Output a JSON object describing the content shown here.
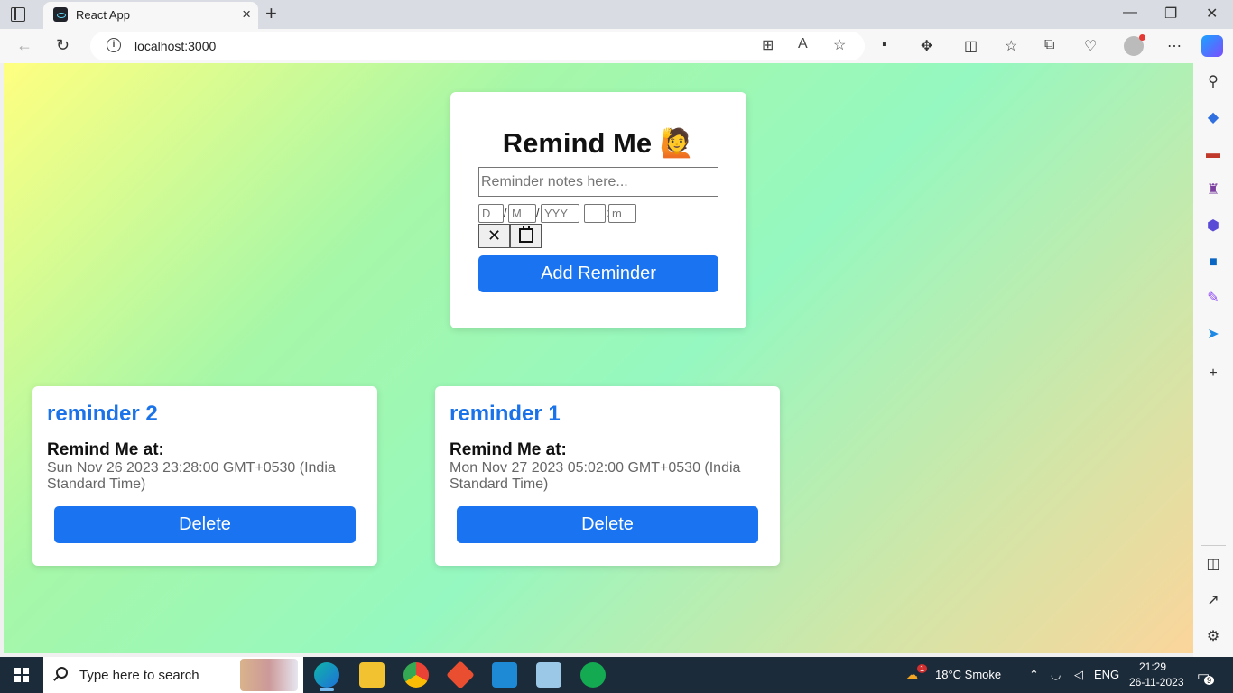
{
  "browser": {
    "tab_title": "React App",
    "new_tab_symbol": "+",
    "close_tab_symbol": "×",
    "url": "localhost:3000",
    "window_controls": [
      "—",
      "❐",
      "✕"
    ]
  },
  "page": {
    "title": "Remind Me 🙋",
    "note_placeholder": "Reminder notes here...",
    "date_fields": [
      "D",
      "M",
      "YYY",
      "",
      "m"
    ],
    "date_separators": [
      "/",
      "/",
      ":"
    ],
    "clear_symbol": "✕",
    "add_button": "Add Reminder",
    "reminders": [
      {
        "title": "reminder 2",
        "label": "Remind Me at:",
        "time": "Sun Nov 26 2023 23:28:00 GMT+0530 (India Standard Time)",
        "delete": "Delete"
      },
      {
        "title": "reminder 1",
        "label": "Remind Me at:",
        "time": "Mon Nov 27 2023 05:02:00 GMT+0530 (India Standard Time)",
        "delete": "Delete"
      }
    ]
  },
  "taskbar": {
    "search_placeholder": "Type here to search",
    "weather": "18°C  Smoke",
    "weather_badge": "1",
    "language": "ENG",
    "time": "21:29",
    "date": "26-11-2023",
    "notification_count": "9"
  },
  "colors": {
    "accent": "#1a73f0",
    "title_blue": "#1a73e8",
    "taskbar": "#1c2b3a"
  }
}
